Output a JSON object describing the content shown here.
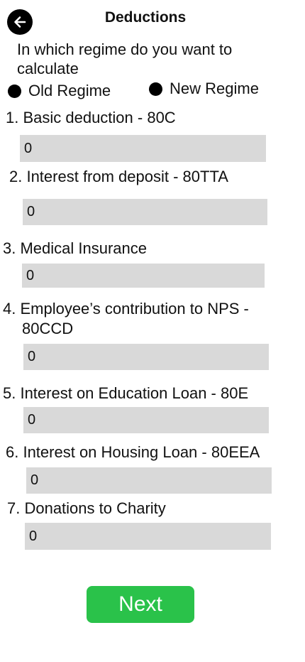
{
  "header": {
    "title": "Deductions",
    "back_icon": "arrow-left-icon"
  },
  "regime": {
    "question": "In which regime do you want to calculate",
    "options": [
      "Old Regime",
      "New Regime"
    ]
  },
  "deductions": [
    {
      "label": "1. Basic deduction - 80C",
      "value": "0"
    },
    {
      "label": "2. Interest from deposit - 80TTA",
      "value": "0"
    },
    {
      "label": "3. Medical Insurance",
      "value": "0"
    },
    {
      "label": "4. Employee’s contribution to NPS -",
      "label_line2": "80CCD",
      "value": "0"
    },
    {
      "label": "5. Interest on Education Loan - 80E",
      "value": "0"
    },
    {
      "label": "6. Interest on Housing Loan - 80EEA",
      "value": "0"
    },
    {
      "label": "7. Donations to Charity",
      "value": "0"
    }
  ],
  "next_label": "Next",
  "colors": {
    "accent": "#2ac24a",
    "field_bg": "#d9d9d9"
  }
}
